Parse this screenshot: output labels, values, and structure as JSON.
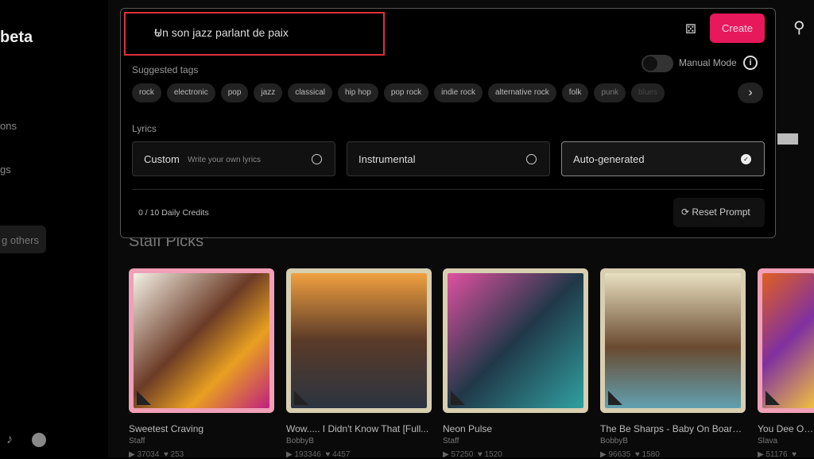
{
  "sidebar": {
    "title": "beta",
    "items": [
      "ons",
      "gs"
    ],
    "pill": "g others",
    "social": [
      "tiktok-icon",
      "reddit-icon"
    ]
  },
  "prompt": {
    "value": "Un son jazz parlant de paix"
  },
  "header": {
    "create_label": "Create",
    "manual_mode_label": "Manual Mode"
  },
  "tags": {
    "label": "Suggested tags",
    "items": [
      "rock",
      "electronic",
      "pop",
      "jazz",
      "classical",
      "hip hop",
      "pop rock",
      "indie rock",
      "alternative rock",
      "folk",
      "punk",
      "blues"
    ]
  },
  "lyrics": {
    "label": "Lyrics",
    "options": [
      {
        "title": "Custom",
        "subtitle": "Write your own lyrics",
        "selected": false
      },
      {
        "title": "Instrumental",
        "selected": false
      },
      {
        "title": "Auto-generated",
        "selected": true
      }
    ]
  },
  "footer": {
    "credits": "0 / 10 Daily Credits",
    "reset_label": "Reset Prompt"
  },
  "section": {
    "title": "Staff Picks"
  },
  "cards": [
    {
      "title": "Sweetest Craving",
      "author": "Staff",
      "plays": "37034",
      "likes": "253",
      "frame": "#f0a0b8"
    },
    {
      "title": "Wow..... I Didn't Know That [Full...",
      "author": "BobbyB",
      "plays": "193346",
      "likes": "4457",
      "frame": "#d8cfb0"
    },
    {
      "title": "Neon Pulse",
      "author": "Staff",
      "plays": "57250",
      "likes": "1520",
      "frame": "#d8cfb0"
    },
    {
      "title": "The Be Sharps - Baby On Board,...",
      "author": "BobbyB",
      "plays": "96635",
      "likes": "1580",
      "frame": "#d8cfb0"
    },
    {
      "title": "You Dee Oh (",
      "author": "Slava",
      "plays": "51176",
      "likes": "",
      "frame": "#f0a0b8"
    }
  ],
  "colors": {
    "accent": "#e8185d",
    "highlight_box": "#e0303a"
  }
}
